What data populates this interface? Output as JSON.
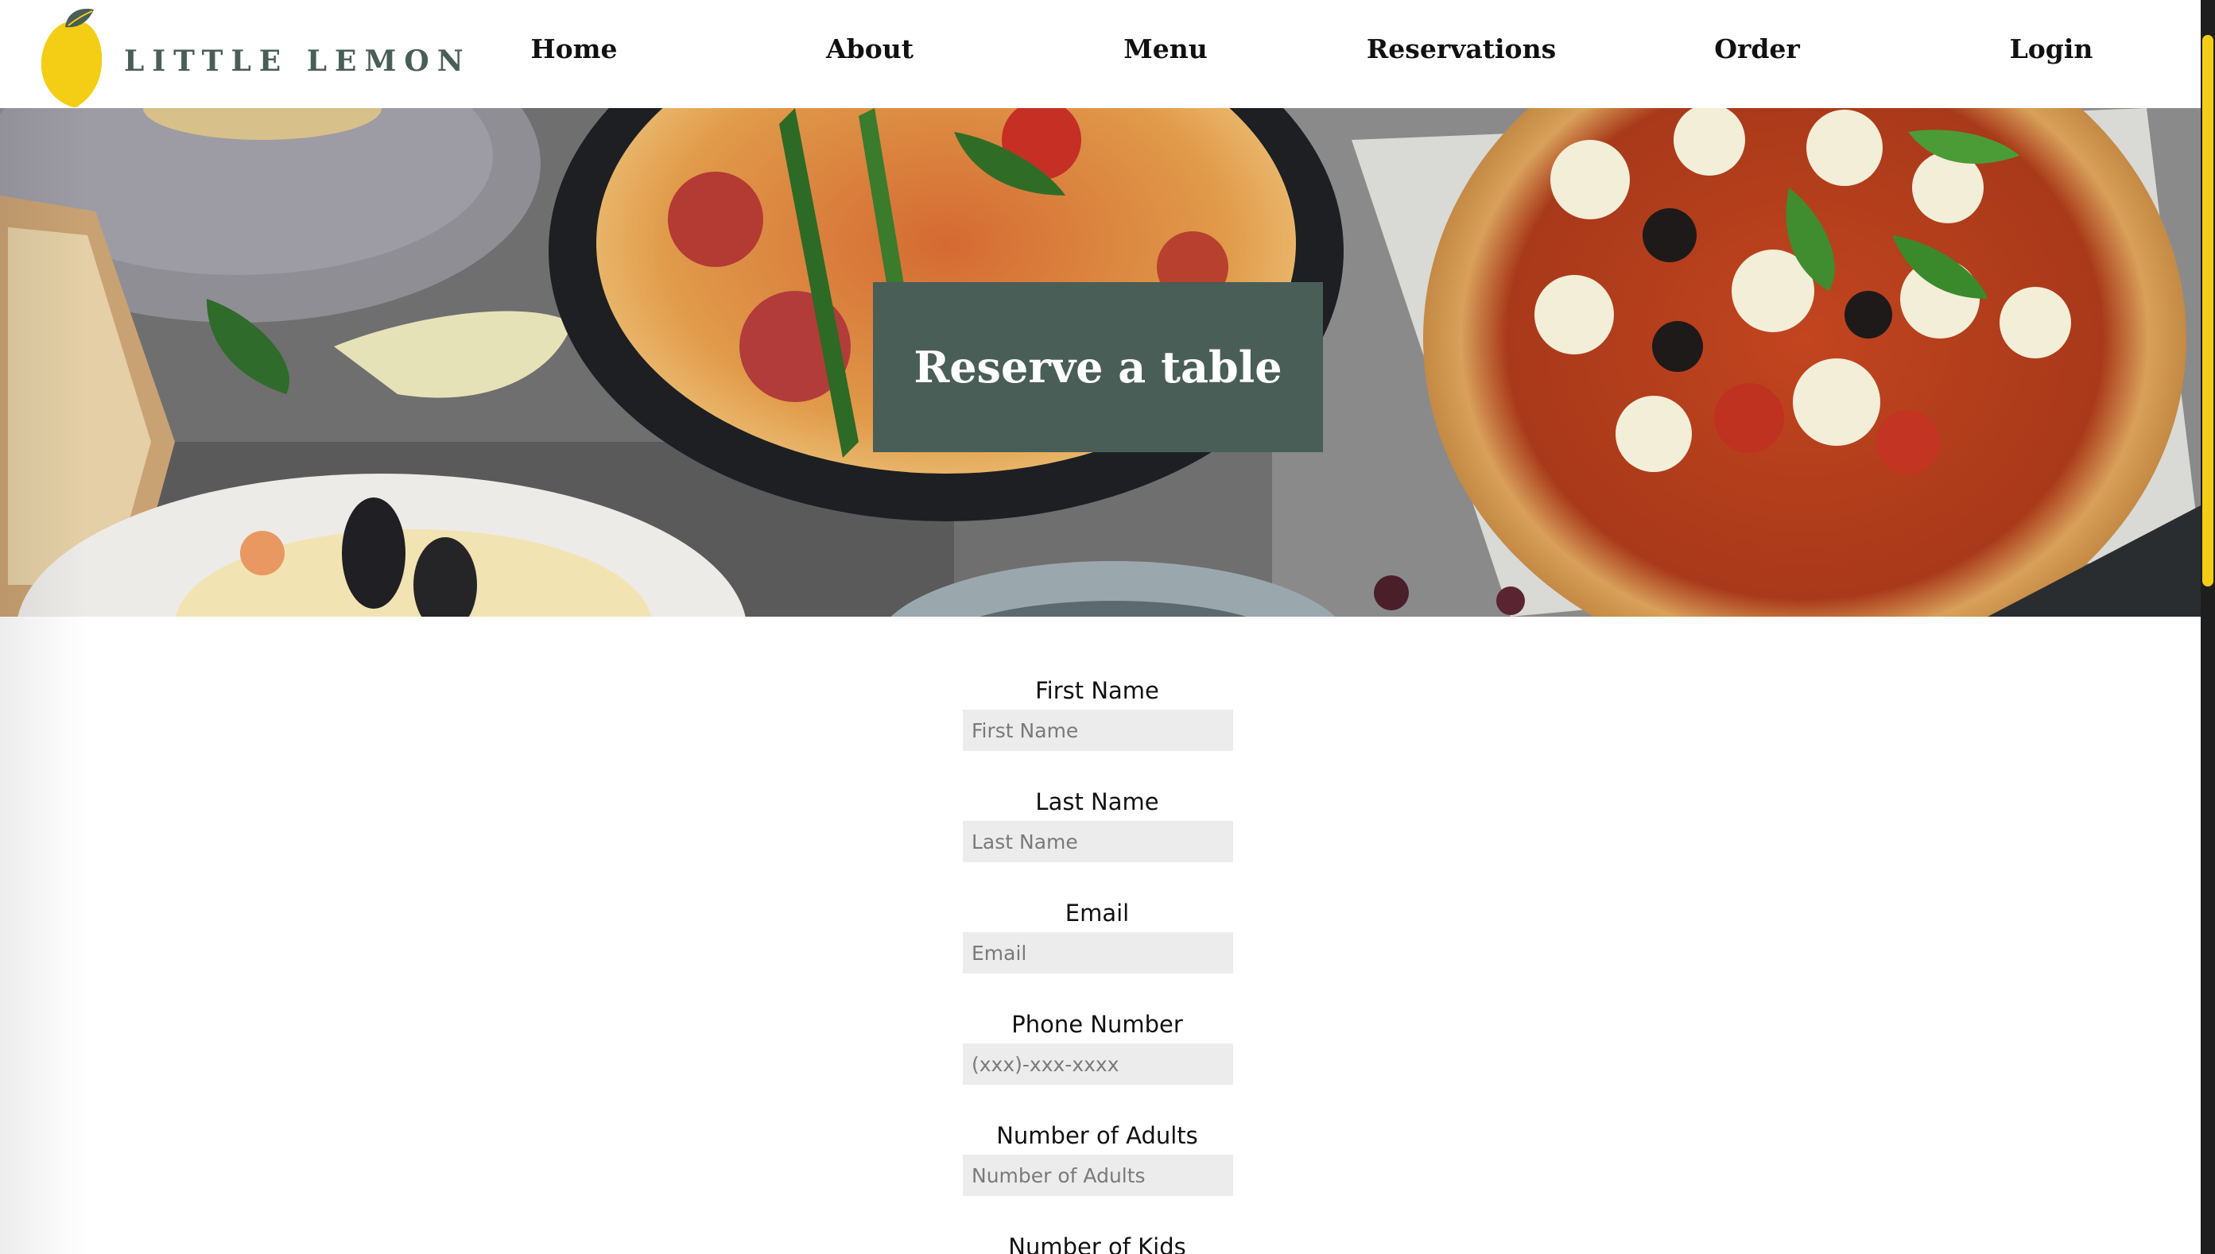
{
  "brand": {
    "name": "LITTLE LEMON",
    "primary_color": "#495e57",
    "accent_color": "#f4ce14"
  },
  "nav": {
    "items": [
      {
        "label": "Home"
      },
      {
        "label": "About"
      },
      {
        "label": "Menu"
      },
      {
        "label": "Reservations"
      },
      {
        "label": "Order"
      },
      {
        "label": "Login"
      }
    ]
  },
  "hero": {
    "title": "Reserve a table",
    "image": "food-photo"
  },
  "form": {
    "fields": [
      {
        "label": "First Name",
        "placeholder": "First Name"
      },
      {
        "label": "Last Name",
        "placeholder": "Last Name"
      },
      {
        "label": "Email",
        "placeholder": "Email"
      },
      {
        "label": "Phone Number",
        "placeholder": "(xxx)-xxx-xxxx"
      },
      {
        "label": "Number of Adults",
        "placeholder": "Number of Adults"
      },
      {
        "label": "Number of Kids",
        "placeholder": ""
      }
    ]
  },
  "icons": {
    "logo": "lemon-logo-icon"
  }
}
